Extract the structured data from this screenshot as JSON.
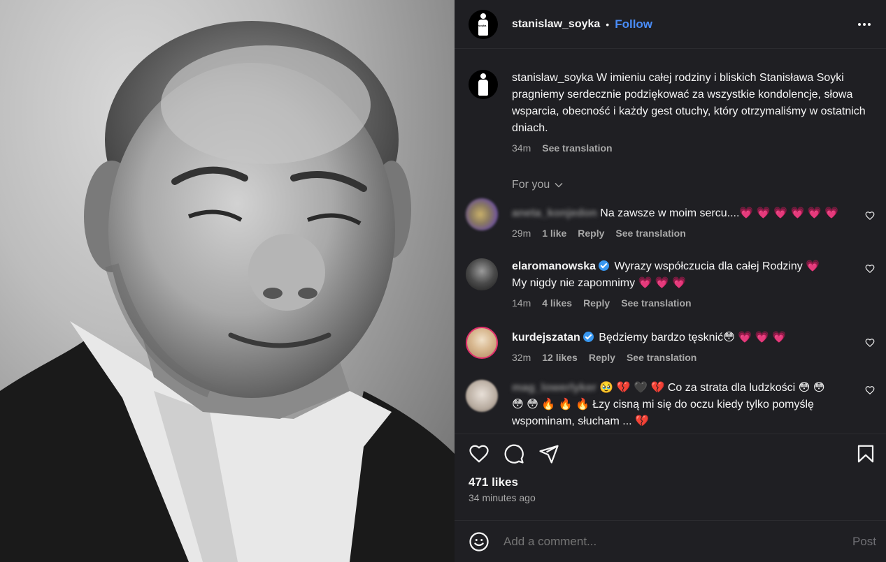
{
  "post": {
    "username": "stanislaw_soyka",
    "follow_label": "Follow",
    "avatar_tag": "soyka",
    "caption_username": "stanislaw_soyka",
    "caption_text": "W imieniu całej rodziny i bliskich Stanisława Soyki pragniemy serdecznie podziękować za wszystkie kondolencje, słowa wsparcia, obecność i każdy gest otuchy, który otrzymaliśmy w ostatnich dniach.",
    "caption_time": "34m",
    "see_translation": "See translation",
    "sort_label": "For you"
  },
  "comments": [
    {
      "username": "aneta_konjedon",
      "blurred": true,
      "text": "Na zawsze w moim sercu....💗 💗 💗 💗 💗 💗",
      "time": "29m",
      "likes": "1 like",
      "reply": "Reply",
      "translate": "See translation"
    },
    {
      "username": "elaromanowska",
      "verified": true,
      "text": "Wyrazy współczucia dla całej Rodziny 💗",
      "text2": "My nigdy nie zapomnimy  💗 💗 💗",
      "time": "14m",
      "likes": "4 likes",
      "reply": "Reply",
      "translate": "See translation"
    },
    {
      "username": "kurdejszatan",
      "verified": true,
      "text": "Będziemy bardzo tęsknić😳 💗 💗 💗",
      "time": "32m",
      "likes": "12 likes",
      "reply": "Reply",
      "translate": "See translation"
    },
    {
      "username": "mag_lowerlyker",
      "blurred": true,
      "text": "🥹 💔 🖤 💔  Co za strata dla ludzkości  😳 😳",
      "text2": "😳 😳 🔥 🔥 🔥  Łzy cisną mi się do oczu kiedy tylko pomyślę",
      "text3": "wspominam, słucham ... 💔"
    }
  ],
  "footer": {
    "likes": "471 likes",
    "time_ago": "34 minutes ago",
    "comment_placeholder": "Add a comment...",
    "post_label": "Post"
  },
  "colors": {
    "panel_bg": "#1f1f23",
    "link_blue": "#4a8df8",
    "muted": "#a8a8a8",
    "heart_pink": "#ff3e79"
  },
  "icons": {
    "like": "heart-icon",
    "comment": "comment-icon",
    "share": "share-icon",
    "save": "bookmark-icon",
    "emoji": "emoji-icon",
    "more": "more-options-icon",
    "sort": "chevron-down-icon"
  }
}
